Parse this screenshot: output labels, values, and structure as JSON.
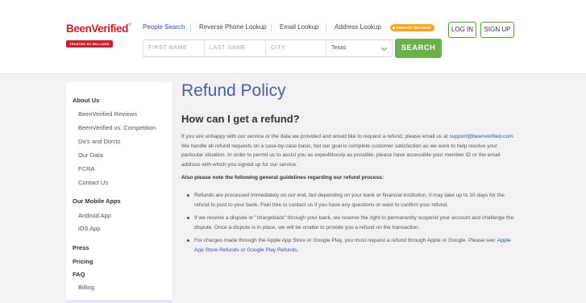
{
  "brand": {
    "logo_name": "BeenVerified",
    "logo_badge": "TRUSTED BY MILLIONS",
    "brand_color": "#c8202f"
  },
  "nav": {
    "items": [
      {
        "label": "People Search",
        "active": true
      },
      {
        "label": "Reverse Phone Lookup",
        "active": false
      },
      {
        "label": "Email Lookup",
        "active": false
      },
      {
        "label": "Address Lookup",
        "active": false
      }
    ],
    "privacy_badge": "PRIVACY SECURED",
    "login": "LOG IN",
    "signup": "SIGN UP"
  },
  "search": {
    "first_name_placeholder": "FIRST NAME",
    "last_name_placeholder": "LAST NAME",
    "city_placeholder": "CITY",
    "state_value": "Texas",
    "button": "SEARCH",
    "button_color": "#6ab04c"
  },
  "sidebar": {
    "about_heading": "About Us",
    "about_items": [
      "BeenVerified Reviews",
      "BeenVerified vs. Competition",
      "Do's and Don'ts",
      "Our Data",
      "FCRA",
      "Contact Us"
    ],
    "apps_heading": "Our Mobile Apps",
    "apps_items": [
      "Android App",
      "iOS App"
    ],
    "press": "Press",
    "pricing": "Pricing",
    "faq": "FAQ",
    "faq_items": [
      "Billing"
    ]
  },
  "content": {
    "title": "Refund Policy",
    "subtitle": "How can I get a refund?",
    "intro_before_link": "If you are unhappy with our service or the data we provided and would like to request a refund, please email us at ",
    "support_email": "support@beenverified.com",
    "intro_after_link": ". We handle all refund requests on a case-by-case basis, but our goal is complete customer satisfaction as we work to help resolve your particular situation. In order to permit us to assist you as expeditiously as possible, please have accessible your member ID or the email address with which you signed up for our service.",
    "guidelines_note": "Also please note the following general guidelines regarding our refund process:",
    "bullets": [
      "Refunds are processed immediately on our end, but depending on your bank or financial institution, it may take up to 10 days for the refund to post to your bank. Feel free to contact us if you have any questions or want to confirm your refund.",
      "If we receive a dispute or \"chargeback\" through your bank, we reserve the right to permanently suspend your account and challenge the dispute. Once a dispute is in place, we will be unable to provide you a refund on the transaction."
    ],
    "bullet3_before": "For charges made through the Apple App Store or Google Play, you must request a refund through Apple or Google. Please see: ",
    "apple_link": "Apple App Store Refunds",
    "bullet3_or": " or ",
    "google_link": "Google Play Refunds",
    "bullet3_end": "."
  },
  "colors": {
    "title": "#4d5f9e",
    "link": "#3a4fa8"
  }
}
